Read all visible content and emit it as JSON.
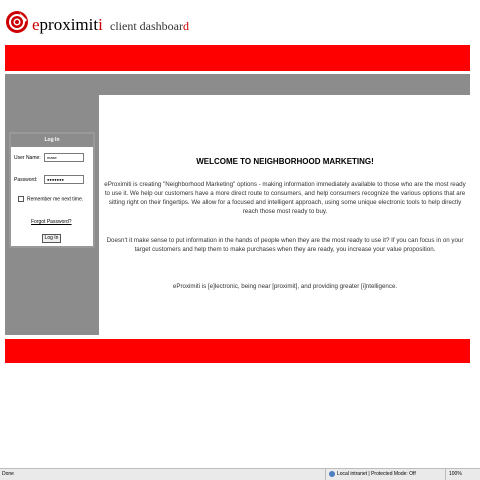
{
  "header": {
    "logo_e": "e",
    "logo_main": "proximit",
    "logo_i": "i",
    "subtitle_main": "client dashboar",
    "subtitle_d": "d"
  },
  "login": {
    "title": "Log In",
    "username_label": "User Name:",
    "username_value": "mase",
    "password_label": "Password:",
    "password_value": "●●●●●●●",
    "remember_label": "Remember me next time.",
    "forgot_label": "Forgot Password?",
    "button_label": "Log In"
  },
  "main": {
    "heading": "WELCOME TO NEIGHBORHOOD MARKETING!",
    "paragraph1": "eProximiti is creating \"Neighborhood Marketing\" options - making information immediately available to those who are the most ready to use it. We help our customers have a more direct route to consumers, and help consumers recognize the various options that are sitting right on their fingertips. We allow for a focused and intelligent approach, using some unique electronic tools to help directly reach those most ready to buy.",
    "paragraph2": "Doesn't it make sense to put information in the hands of people when they are the most ready to use it? If you can focus in on your target customers and help them to make purchases when they are ready, you increase your value proposition.",
    "paragraph3": "eProximiti is [e]lectronic, being near [proximit], and providing greater [i]ntelligence."
  },
  "statusbar": {
    "left": "Done",
    "zone": "Local intranet | Protected Mode: Off",
    "zoom": "100%"
  },
  "colors": {
    "accent_red": "#ff0000",
    "gray": "#8c8c8c",
    "logo_red": "#cc0000"
  },
  "icons": [
    "eproximiti-logo-icon",
    "globe-icon",
    "checkbox-icon"
  ]
}
